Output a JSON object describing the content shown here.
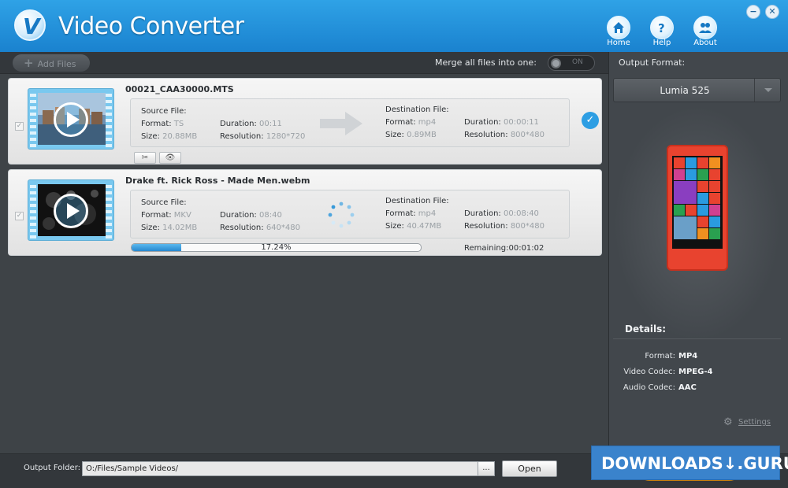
{
  "app": {
    "title": "Video Converter",
    "logo_letter": "V"
  },
  "nav": {
    "home": "Home",
    "help": "Help",
    "about": "About"
  },
  "window": {
    "minimize": "−",
    "close": "✕"
  },
  "toolbar": {
    "add_files": "Add Files",
    "merge_label": "Merge all files into one:",
    "merge_toggle": "ON"
  },
  "files": [
    {
      "name": "00021_CAA30000.MTS",
      "source_label": "Source File:",
      "source": {
        "format_label": "Format:",
        "format": "TS",
        "duration_label": "Duration:",
        "duration": "00:11",
        "size_label": "Size:",
        "size": "20.88MB",
        "resolution_label": "Resolution:",
        "resolution": "1280*720"
      },
      "dest_label": "Destination File:",
      "dest": {
        "format_label": "Format:",
        "format": "mp4",
        "duration_label": "Duration:",
        "duration": "00:00:11",
        "size_label": "Size:",
        "size": "0.89MB",
        "resolution_label": "Resolution:",
        "resolution": "800*480"
      },
      "tools": {
        "cut": "✂",
        "preview": "👁"
      },
      "status": "done"
    },
    {
      "name": "Drake ft. Rick Ross - Made Men.webm",
      "source_label": "Source File:",
      "source": {
        "format_label": "Format:",
        "format": "MKV",
        "duration_label": "Duration:",
        "duration": "08:40",
        "size_label": "Size:",
        "size": "14.02MB",
        "resolution_label": "Resolution:",
        "resolution": "640*480"
      },
      "dest_label": "Destination File:",
      "dest": {
        "format_label": "Format:",
        "format": "mp4",
        "duration_label": "Duration:",
        "duration": "00:08:40",
        "size_label": "Size:",
        "size": "40.47MB",
        "resolution_label": "Resolution:",
        "resolution": "800*480"
      },
      "progress": 0.1724,
      "progress_text": "17.24%",
      "remaining": "Remaining:00:01:02",
      "status": "converting"
    }
  ],
  "output_panel": {
    "label": "Output Format:",
    "device": "Lumia 525",
    "details_title": "Details:",
    "details": [
      {
        "label": "Format:",
        "value": "MP4"
      },
      {
        "label": "Video Codec:",
        "value": "MPEG-4"
      },
      {
        "label": "Audio Codec:",
        "value": "AAC"
      }
    ],
    "settings": "Settings"
  },
  "bottom": {
    "output_folder_label": "Output Folder:",
    "output_folder": "O:/Files/Sample Videos/",
    "browse": "...",
    "open": "Open"
  },
  "watermark": "DOWNLOADS↓.GURU",
  "colors": {
    "accent": "#1a82cf",
    "phone": "#e8432f",
    "progress": "#2788cf",
    "convert": "#e69a16"
  }
}
